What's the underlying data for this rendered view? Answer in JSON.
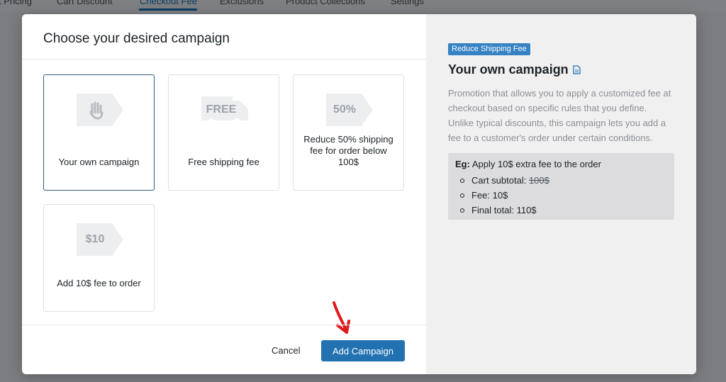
{
  "background_nav": {
    "tabs": [
      "t Pricing",
      "Cart Discount",
      "Checkout Fee",
      "Exclusions",
      "Product Collections",
      "Settings"
    ],
    "active_tab": "Checkout Fee"
  },
  "modal": {
    "title": "Choose your desired campaign",
    "cards": [
      {
        "label": "Your own campaign",
        "icon": "hand-tag-icon",
        "selected": true
      },
      {
        "label": "Free shipping fee",
        "icon_text": "FREE",
        "icon": "truck-tag-icon"
      },
      {
        "label": "Reduce 50% shipping fee for order below 100$",
        "icon_text": "50%",
        "icon": "percent-tag-icon"
      },
      {
        "label": "Add 10$ fee to order",
        "icon_text": "$10",
        "icon": "dollar-tag-icon"
      }
    ],
    "cancel_label": "Cancel",
    "add_label": "Add Campaign"
  },
  "detail": {
    "badge": "Reduce Shipping Fee",
    "title": "Your own campaign",
    "description": "Promotion that allows you to apply a customized fee at checkout based on specific rules that you define. Unlike typical discounts, this campaign lets you add a fee to a customer's order under certain conditions.",
    "example": {
      "prefix": "Eg:",
      "text": "Apply 10$ extra fee to the order",
      "items": [
        {
          "label": "Cart subtotal: ",
          "value": "100$",
          "strike": true
        },
        {
          "label": "Fee: 10$"
        },
        {
          "label": "Final total: 110$"
        }
      ]
    }
  },
  "colors": {
    "primary": "#2271b1",
    "badge": "#3582c4",
    "selected_border": "#2e5c8a",
    "arrow": "#e0191b",
    "overlay": "#7b7d80"
  }
}
